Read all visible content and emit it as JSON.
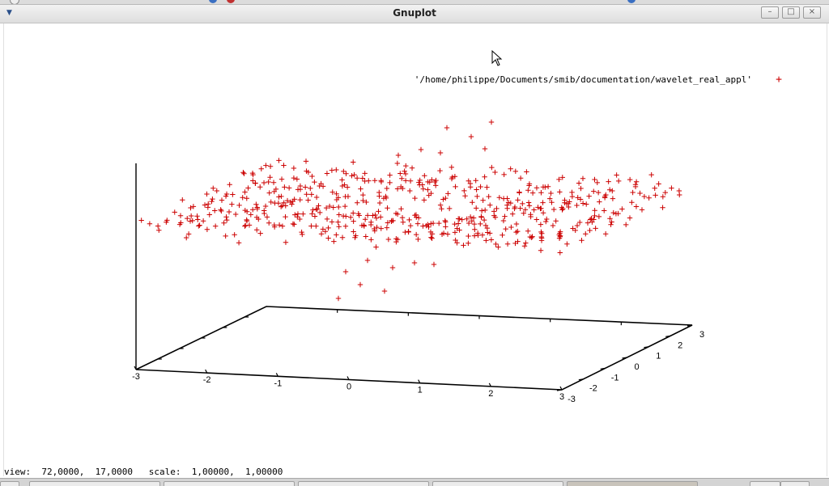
{
  "window": {
    "title": "Gnuplot",
    "controls": [
      "minimize",
      "maximize",
      "close"
    ]
  },
  "status": {
    "view": "view:  72,0000,  17,0000   scale:  1,00000,  1,00000"
  },
  "chart_data": {
    "type": "scatter",
    "view_rotation": [
      72,
      17
    ],
    "scale": [
      1,
      1
    ],
    "legend": {
      "label": "'/home/philippe/Documents/smib/documentation/wavelet_real_appl'",
      "marker": "+",
      "placement": "top-right"
    },
    "x_axis": {
      "range": [
        -3,
        3
      ],
      "ticks": [
        "-3",
        "-2",
        "-1",
        "0",
        "1",
        "2",
        "3"
      ]
    },
    "y_axis": {
      "range": [
        -3,
        3
      ],
      "ticks": [
        "-3",
        "-2",
        "-1",
        "0",
        "1",
        "2",
        "3"
      ]
    },
    "z_axis": {
      "range": [
        -1,
        1
      ],
      "ticks": []
    },
    "grid": false,
    "series_color": "#cc0000",
    "axis_color": "#000000"
  }
}
